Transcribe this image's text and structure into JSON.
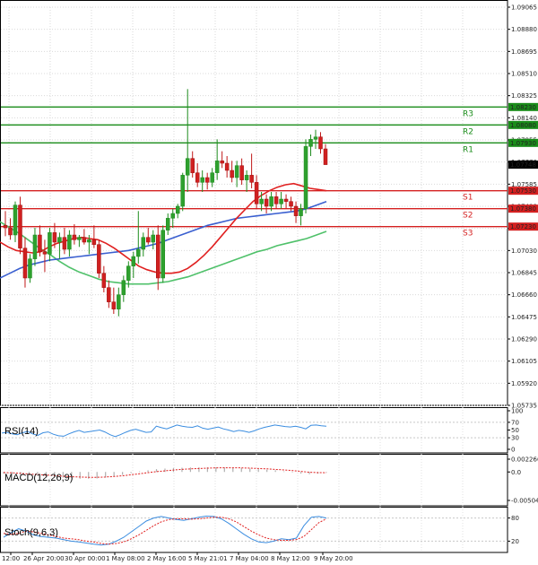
{
  "chart_data": [
    {
      "type": "candlestick",
      "ylim": [
        1.05735,
        1.09065
      ],
      "price_ticks": [
        "1.09065",
        "1.08880",
        "1.08695",
        "1.08510",
        "1.08325",
        "1.08140",
        "1.07955",
        "1.07770",
        "1.07585",
        "1.07400",
        "1.07215",
        "1.07030",
        "1.06845",
        "1.06660",
        "1.06475",
        "1.06290",
        "1.06105",
        "1.05920",
        "1.05735"
      ],
      "x_tick_labels": [
        "12:00",
        "26 Apr 20:00",
        "30 Apr 00:00",
        "1 May 08:00",
        "2 May 16:00",
        "5 May 21:01",
        "7 May 04:00",
        "8 May 12:00",
        "9 May 20:00"
      ],
      "current_price": {
        "label": "1.07748",
        "value": 1.07748
      },
      "levels": [
        {
          "name": "R3",
          "value": 1.0823,
          "label": "1.08230",
          "kind": "resistance"
        },
        {
          "name": "R2",
          "value": 1.0808,
          "label": "1.08080",
          "kind": "resistance"
        },
        {
          "name": "R1",
          "value": 1.0793,
          "label": "1.07930",
          "kind": "resistance"
        },
        {
          "name": "S1",
          "value": 1.0753,
          "label": "1.07530",
          "kind": "support"
        },
        {
          "name": "S2",
          "value": 1.0738,
          "label": "1.07380",
          "kind": "support"
        },
        {
          "name": "S3",
          "value": 1.0723,
          "label": "1.07230",
          "kind": "support"
        }
      ],
      "candles": [
        [
          1.0724,
          1.0736,
          1.0715,
          1.0722
        ],
        [
          1.0722,
          1.073,
          1.0712,
          1.0716
        ],
        [
          1.0716,
          1.0744,
          1.071,
          1.0741
        ],
        [
          1.0741,
          1.0748,
          1.07,
          1.0705
        ],
        [
          1.0705,
          1.0714,
          1.0672,
          1.068
        ],
        [
          1.068,
          1.07,
          1.0676,
          1.0696
        ],
        [
          1.0696,
          1.0722,
          1.069,
          1.0716
        ],
        [
          1.0716,
          1.0724,
          1.0698,
          1.0702
        ],
        [
          1.0702,
          1.0712,
          1.0685,
          1.07
        ],
        [
          1.07,
          1.0722,
          1.0694,
          1.0718
        ],
        [
          1.0718,
          1.0726,
          1.0705,
          1.071
        ],
        [
          1.071,
          1.0718,
          1.0696,
          1.0714
        ],
        [
          1.0714,
          1.0722,
          1.07,
          1.0704
        ],
        [
          1.0704,
          1.072,
          1.0698,
          1.0716
        ],
        [
          1.0716,
          1.0725,
          1.0708,
          1.0712
        ],
        [
          1.0712,
          1.0716,
          1.0706,
          1.0714
        ],
        [
          1.0714,
          1.0721,
          1.0708,
          1.071
        ],
        [
          1.071,
          1.0716,
          1.07,
          1.0712
        ],
        [
          1.0712,
          1.0724,
          1.0705,
          1.0708
        ],
        [
          1.0708,
          1.0712,
          1.068,
          1.0684
        ],
        [
          1.0684,
          1.069,
          1.0668,
          1.0672
        ],
        [
          1.0672,
          1.0678,
          1.0655,
          1.066
        ],
        [
          1.066,
          1.0672,
          1.065,
          1.0654
        ],
        [
          1.0654,
          1.0672,
          1.0648,
          1.0666
        ],
        [
          1.0666,
          1.0682,
          1.066,
          1.0678
        ],
        [
          1.0678,
          1.0694,
          1.0672,
          1.069
        ],
        [
          1.069,
          1.0702,
          1.068,
          1.0698
        ],
        [
          1.0698,
          1.0736,
          1.0692,
          1.0704
        ],
        [
          1.0704,
          1.0718,
          1.0698,
          1.0714
        ],
        [
          1.0714,
          1.0722,
          1.0708,
          1.071
        ],
        [
          1.071,
          1.072,
          1.0704,
          1.0716
        ],
        [
          1.0716,
          1.0724,
          1.067,
          1.068
        ],
        [
          1.068,
          1.0724,
          1.0676,
          1.072
        ],
        [
          1.072,
          1.0734,
          1.0716,
          1.073
        ],
        [
          1.073,
          1.0738,
          1.0722,
          1.0734
        ],
        [
          1.0734,
          1.0742,
          1.073,
          1.074
        ],
        [
          1.074,
          1.0768,
          1.0736,
          1.0766
        ],
        [
          1.0766,
          1.0838,
          1.0752,
          1.078
        ],
        [
          1.078,
          1.0786,
          1.0764,
          1.0768
        ],
        [
          1.0768,
          1.0776,
          1.0756,
          1.076
        ],
        [
          1.076,
          1.077,
          1.0752,
          1.0764
        ],
        [
          1.0764,
          1.0768,
          1.0754,
          1.076
        ],
        [
          1.076,
          1.0772,
          1.0756,
          1.0768
        ],
        [
          1.0768,
          1.0796,
          1.0762,
          1.0778
        ],
        [
          1.0778,
          1.0786,
          1.0772,
          1.0776
        ],
        [
          1.0776,
          1.0782,
          1.0764,
          1.077
        ],
        [
          1.077,
          1.0778,
          1.076,
          1.0764
        ],
        [
          1.0764,
          1.0778,
          1.0756,
          1.0774
        ],
        [
          1.0774,
          1.078,
          1.0758,
          1.0762
        ],
        [
          1.0762,
          1.077,
          1.0752,
          1.0766
        ],
        [
          1.0766,
          1.0784,
          1.0755,
          1.076
        ],
        [
          1.076,
          1.0766,
          1.0738,
          1.0742
        ],
        [
          1.0742,
          1.0752,
          1.0736,
          1.0746
        ],
        [
          1.0746,
          1.075,
          1.0734,
          1.074
        ],
        [
          1.074,
          1.0752,
          1.0736,
          1.0748
        ],
        [
          1.0748,
          1.0752,
          1.0738,
          1.0742
        ],
        [
          1.0742,
          1.0752,
          1.0738,
          1.0746
        ],
        [
          1.0746,
          1.075,
          1.0738,
          1.0744
        ],
        [
          1.0744,
          1.0748,
          1.0736,
          1.074
        ],
        [
          1.074,
          1.0744,
          1.0726,
          1.0732
        ],
        [
          1.0732,
          1.0742,
          1.0724,
          1.0738
        ],
        [
          1.0738,
          1.0796,
          1.0734,
          1.079
        ],
        [
          1.079,
          1.08,
          1.0782,
          1.0796
        ],
        [
          1.0796,
          1.0804,
          1.0788,
          1.0798
        ],
        [
          1.0798,
          1.0802,
          1.0784,
          1.0788
        ],
        [
          1.0788,
          1.0792,
          1.0778,
          1.07748
        ]
      ],
      "ma_red": [
        1.071,
        1.0706,
        1.0703,
        1.0702,
        1.0701,
        1.0702,
        1.0706,
        1.0709,
        1.0711,
        1.0713,
        1.0714,
        1.0713,
        1.0712,
        1.0709,
        1.0705,
        1.07,
        1.0695,
        1.069,
        1.0687,
        1.0685,
        1.0684,
        1.0684,
        1.0685,
        1.0688,
        1.0693,
        1.0699,
        1.0706,
        1.0714,
        1.0722,
        1.073,
        1.0737,
        1.0744,
        1.0749,
        1.0753,
        1.0756,
        1.0758,
        1.0759,
        1.0757,
        1.0755,
        1.0754,
        1.0753
      ],
      "ma_blue": [
        1.068,
        1.0684,
        1.0688,
        1.0691,
        1.0693,
        1.0695,
        1.0696,
        1.0697,
        1.0698,
        1.0699,
        1.07,
        1.0701,
        1.0702,
        1.0703,
        1.0705,
        1.0707,
        1.0709,
        1.0712,
        1.0715,
        1.0718,
        1.0721,
        1.0724,
        1.0726,
        1.0728,
        1.073,
        1.0731,
        1.0732,
        1.0733,
        1.0734,
        1.0735,
        1.0736,
        1.0738,
        1.0741,
        1.0744
      ],
      "ma_green": [
        1.0727,
        1.0722,
        1.0717,
        1.0711,
        1.0705,
        1.07,
        1.0694,
        1.0689,
        1.0685,
        1.0682,
        1.0679,
        1.0677,
        1.0676,
        1.0675,
        1.0675,
        1.0675,
        1.0676,
        1.0677,
        1.0679,
        1.0681,
        1.0684,
        1.0687,
        1.069,
        1.0693,
        1.0696,
        1.0699,
        1.0702,
        1.0704,
        1.0707,
        1.0709,
        1.0711,
        1.0713,
        1.0716,
        1.0719
      ]
    },
    {
      "type": "line",
      "title": "RSI(14)",
      "y_ticks": [
        "100",
        "70",
        "50",
        "30",
        "0"
      ],
      "ylim": [
        0,
        100
      ],
      "values": [
        42,
        44,
        40,
        38,
        43,
        46,
        40,
        36,
        43,
        45,
        39,
        35,
        34,
        40,
        45,
        49,
        44,
        46,
        48,
        50,
        45,
        38,
        33,
        38,
        44,
        49,
        52,
        48,
        44,
        45,
        60,
        56,
        53,
        58,
        63,
        60,
        58,
        57,
        61,
        55,
        52,
        55,
        58,
        53,
        50,
        46,
        49,
        47,
        44,
        48,
        53,
        57,
        60,
        63,
        61,
        59,
        58,
        60,
        57,
        53,
        62,
        63,
        61,
        60
      ]
    },
    {
      "type": "bar",
      "title": "MACD(12,26,9)",
      "y_ticks": [
        "0.002266",
        "0.0",
        "-0.005046"
      ],
      "ylim": [
        -0.005046,
        0.002266
      ],
      "values": [
        -0.0003,
        -0.0004,
        -0.0005,
        -0.0006,
        -0.0007,
        -0.0008,
        -0.0009,
        -0.001,
        -0.0011,
        -0.0012,
        -0.0012,
        -0.00115,
        -0.001,
        -0.0008,
        -0.0005,
        -0.0002,
        0.0001,
        0.0003,
        0.0005,
        0.0006,
        0.0007,
        0.00075,
        0.0008,
        0.00082,
        0.00083,
        0.00082,
        0.0008,
        0.00075,
        0.0007,
        0.0006,
        0.0005,
        0.0004,
        0.0003,
        0.0001,
        -0.0001,
        -0.0003,
        -0.0004,
        -0.0003,
        -0.0001
      ],
      "signal": [
        -0.0001,
        -0.00015,
        -0.00025,
        -0.00035,
        -0.00045,
        -0.00055,
        -0.00065,
        -0.00075,
        -0.00085,
        -0.0009,
        -0.00095,
        -0.00095,
        -0.0009,
        -0.0008,
        -0.00068,
        -0.0005,
        -0.00032,
        -0.00012,
        5e-05,
        0.0002,
        0.00034,
        0.00046,
        0.00055,
        0.00062,
        0.00068,
        0.00072,
        0.00074,
        0.00074,
        0.00072,
        0.00068,
        0.00062,
        0.00055,
        0.00046,
        0.00036,
        0.00024,
        0.0001,
        -5e-05,
        -0.00012,
        -0.00014
      ]
    },
    {
      "type": "line",
      "title": "Stoch(9,6,3)",
      "y_ticks": [
        "80",
        "20"
      ],
      "ylim": [
        0,
        100
      ],
      "k": [
        30,
        42,
        52,
        46,
        36,
        32,
        30,
        28,
        24,
        20,
        18,
        15,
        12,
        10,
        12,
        20,
        30,
        44,
        58,
        72,
        80,
        84,
        80,
        76,
        74,
        78,
        82,
        85,
        84,
        78,
        66,
        52,
        38,
        26,
        18,
        16,
        20,
        26,
        24,
        28,
        60,
        82,
        84,
        80
      ],
      "d": [
        40,
        38,
        40,
        46,
        44,
        40,
        36,
        32,
        28,
        26,
        24,
        20,
        18,
        14,
        12,
        14,
        18,
        26,
        36,
        48,
        60,
        70,
        76,
        78,
        78,
        77,
        78,
        80,
        82,
        82,
        78,
        70,
        58,
        46,
        36,
        28,
        24,
        22,
        22,
        24,
        32,
        50,
        68,
        78
      ]
    }
  ]
}
